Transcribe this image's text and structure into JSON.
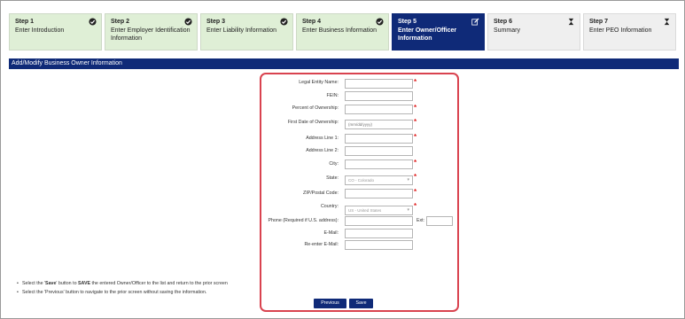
{
  "steps": [
    {
      "num": "Step 1",
      "label": "Enter Introduction",
      "status": "complete",
      "icon": "check-circle-icon"
    },
    {
      "num": "Step 2",
      "label": "Enter Employer Identification Information",
      "status": "complete",
      "icon": "check-circle-icon"
    },
    {
      "num": "Step 3",
      "label": "Enter Liability Information",
      "status": "complete",
      "icon": "check-circle-icon"
    },
    {
      "num": "Step 4",
      "label": "Enter Business Information",
      "status": "complete",
      "icon": "check-circle-icon"
    },
    {
      "num": "Step 5",
      "label": "Enter Owner/Officer Information",
      "status": "active",
      "icon": "edit-icon"
    },
    {
      "num": "Step 6",
      "label": "Summary",
      "status": "pending",
      "icon": "hourglass-icon"
    },
    {
      "num": "Step 7",
      "label": "Enter PEO Information",
      "status": "pending",
      "icon": "hourglass-icon"
    }
  ],
  "section_title": "Add/Modify Business Owner Information",
  "form": {
    "fields": [
      {
        "label": "Legal Entity Name:",
        "value": "",
        "placeholder": "",
        "required": true
      },
      {
        "label": "FEIN:",
        "value": "",
        "placeholder": "",
        "required": false
      },
      {
        "label": "Percent of Ownership:",
        "value": "",
        "placeholder": "",
        "required": true
      },
      {
        "label": "First Date of Ownership:",
        "value": "",
        "placeholder": "(mm/dd/yyyy)",
        "required": true
      },
      {
        "label": "Address Line 1:",
        "value": "",
        "placeholder": "",
        "required": true
      },
      {
        "label": "Address Line 2:",
        "value": "",
        "placeholder": "",
        "required": false
      },
      {
        "label": "City:",
        "value": "",
        "placeholder": "",
        "required": true
      },
      {
        "label": "State:",
        "value": "CO - Colorado",
        "placeholder": "",
        "required": true,
        "type": "select"
      },
      {
        "label": "ZIP/Postal Code:",
        "value": "",
        "placeholder": "",
        "required": true
      },
      {
        "label": "Country:",
        "value": "US - United States",
        "placeholder": "",
        "required": true,
        "type": "select"
      },
      {
        "label": "Phone (Required if U.S. address):",
        "value": "",
        "placeholder": "",
        "required": false
      },
      {
        "label": "E-Mail:",
        "value": "",
        "placeholder": "",
        "required": false
      },
      {
        "label": "Re-enter E-Mail:",
        "value": "",
        "placeholder": "",
        "required": false
      }
    ],
    "ext_label": "Ext:",
    "ext_value": ""
  },
  "instructions": [
    {
      "pre": "Select the '",
      "bold1": "Save",
      "mid": "' button to ",
      "bold2": "SAVE",
      "post": " the entered Owner/Officer to the list and return to the prior screen"
    },
    {
      "pre": "Select the 'Previous' button to navigate to the prior screen without saving the information.",
      "bold1": "",
      "mid": "",
      "bold2": "",
      "post": ""
    }
  ],
  "buttons": {
    "previous": "Previous",
    "save": "Save"
  },
  "colors": {
    "accent": "#0f2a78",
    "complete_bg": "#dfefd6",
    "pending_bg": "#efefef",
    "required": "#e02020",
    "highlight": "#d9434f"
  }
}
